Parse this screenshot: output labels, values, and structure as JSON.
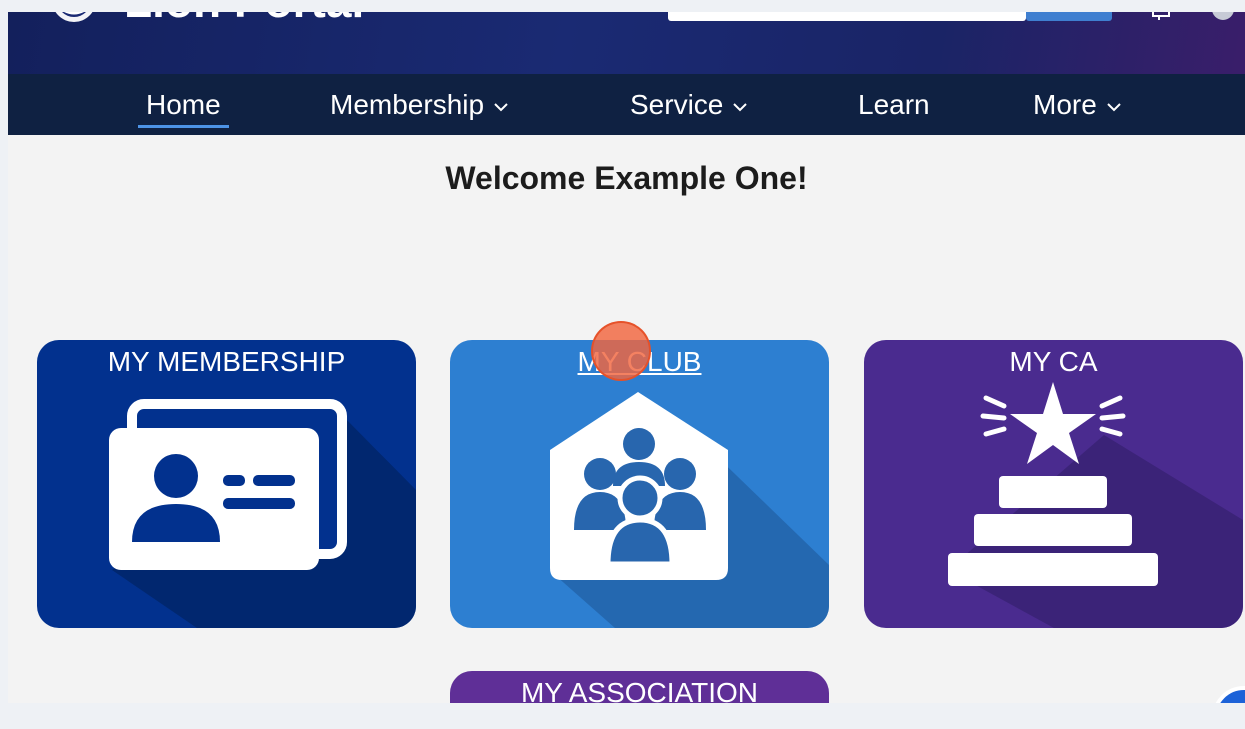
{
  "portal": {
    "title": "Lion Portal"
  },
  "nav": {
    "items": [
      {
        "label": "Home",
        "active": true,
        "has_dropdown": false
      },
      {
        "label": "Membership",
        "active": false,
        "has_dropdown": true
      },
      {
        "label": "Service",
        "active": false,
        "has_dropdown": true
      },
      {
        "label": "Learn",
        "active": false,
        "has_dropdown": false
      },
      {
        "label": "More",
        "active": false,
        "has_dropdown": true
      }
    ]
  },
  "welcome": {
    "text": "Welcome Example One!"
  },
  "tiles": [
    {
      "label": "MY MEMBERSHIP",
      "icon": "id-card-icon",
      "color": "#02318e"
    },
    {
      "label": "MY CLUB",
      "icon": "club-house-icon",
      "color": "#2d7fd1",
      "hovered": true
    },
    {
      "label": "MY CA",
      "icon": "star-podium-icon",
      "color": "#4a2b8f"
    },
    {
      "label": "MY ASSOCIATION",
      "icon": "",
      "color": "#5f2f97"
    }
  ],
  "colors": {
    "nav_background": "#0f2142",
    "nav_active_underline": "#4d93e6",
    "page_background": "#f3f3f3",
    "click_indicator": "#f2653e"
  }
}
